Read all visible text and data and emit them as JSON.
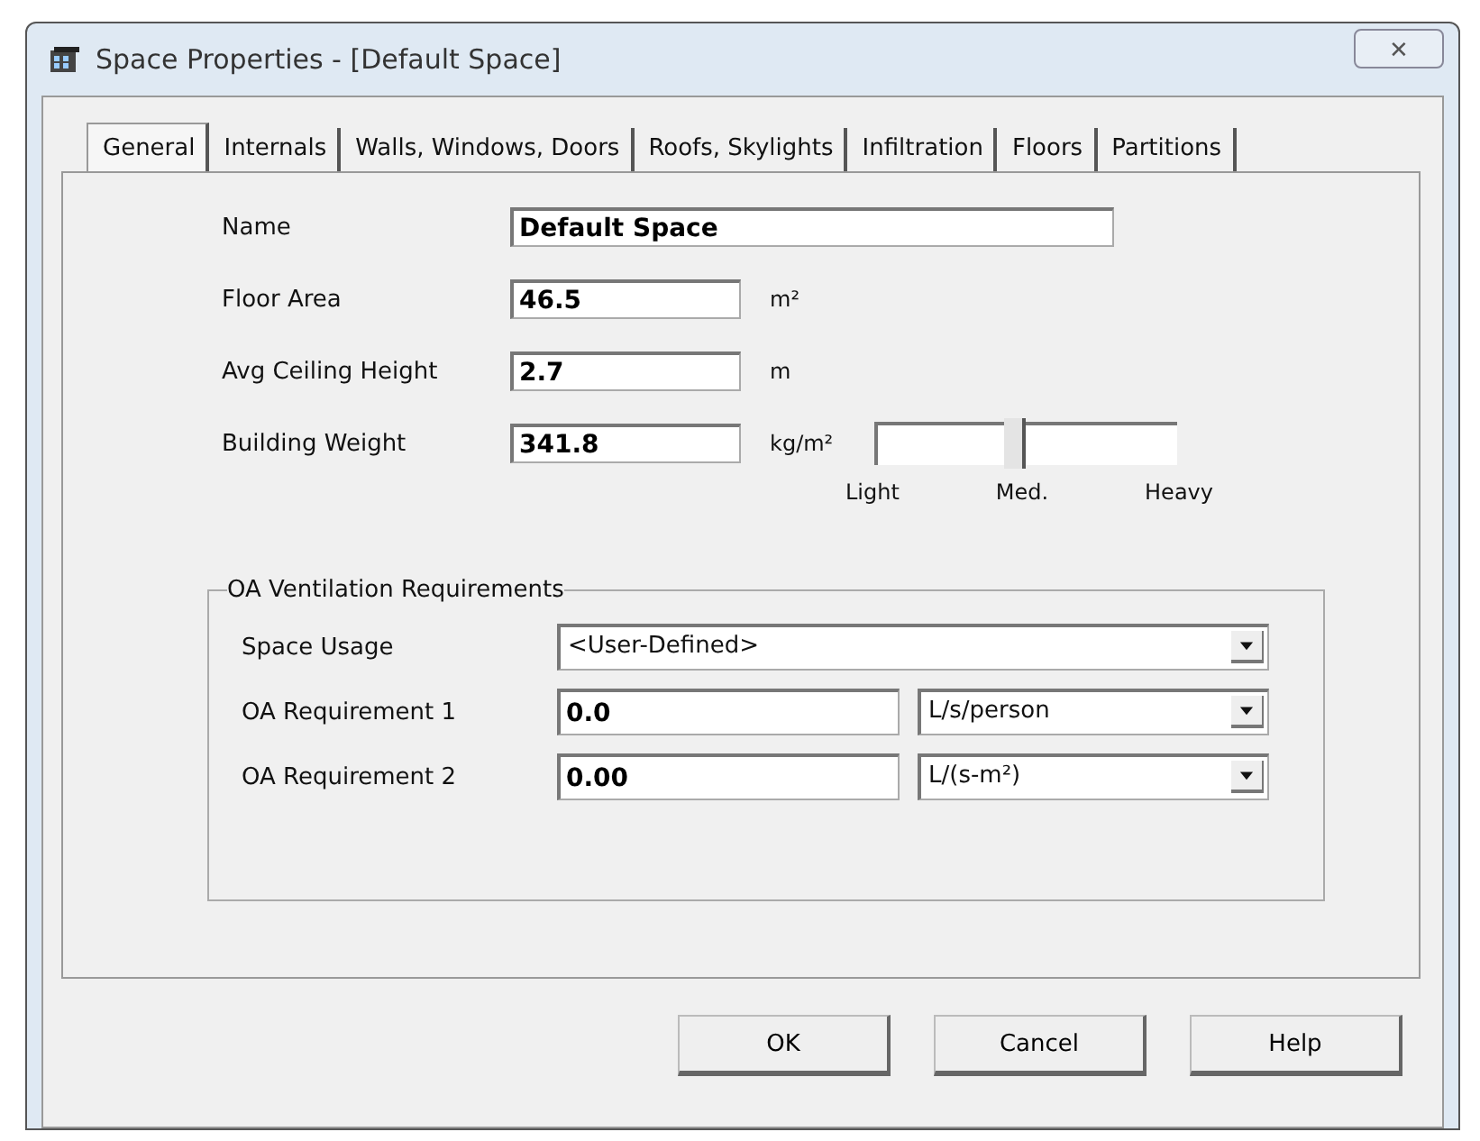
{
  "window": {
    "title": "Space Properties - [Default Space]",
    "close": "✕"
  },
  "tabs": [
    {
      "label": "General",
      "selected": true
    },
    {
      "label": "Internals",
      "selected": false
    },
    {
      "label": "Walls, Windows, Doors",
      "selected": false
    },
    {
      "label": "Roofs, Skylights",
      "selected": false
    },
    {
      "label": "Infiltration",
      "selected": false
    },
    {
      "label": "Floors",
      "selected": false
    },
    {
      "label": "Partitions",
      "selected": false
    }
  ],
  "fields": [
    {
      "label": "Name",
      "value": "Default Space",
      "kind": "wide"
    },
    {
      "label": "Floor Area",
      "value": "46.5",
      "unit": "m²",
      "kind": "short"
    },
    {
      "label": "Avg Ceiling Height",
      "value": "2.7",
      "unit": "m",
      "kind": "short"
    },
    {
      "label": "Building Weight",
      "value": "341.8",
      "unit": "kg/m²",
      "kind": "short"
    }
  ],
  "weight_slider": {
    "level": 0.45,
    "labels": [
      "Light",
      "Med.",
      "Heavy"
    ]
  },
  "ventilation": {
    "title": "OA Ventilation Requirements",
    "usage": {
      "label": "Space Usage",
      "value": "<User-Defined>"
    },
    "requirements": [
      {
        "label": "OA Requirement 1",
        "value": "0.0",
        "unit": "L/s/person"
      },
      {
        "label": "OA Requirement 2",
        "value": "0.00",
        "unit": "L/(s-m²)"
      }
    ]
  },
  "buttons": [
    "OK",
    "Cancel",
    "Help"
  ]
}
